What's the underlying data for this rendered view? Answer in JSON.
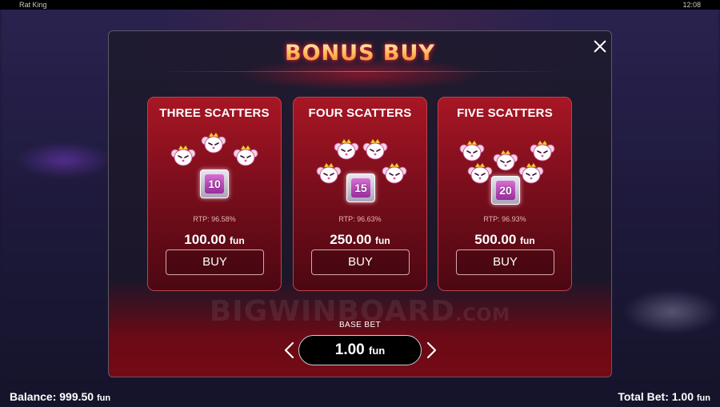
{
  "window": {
    "title": "Rat King",
    "clock": "12:08"
  },
  "modal": {
    "title": "BONUS BUY",
    "close_icon": "close-icon"
  },
  "cards": [
    {
      "title": "THREE SCATTERS",
      "rtp": "RTP: 96.58%",
      "price": "100.00",
      "unit": "fun",
      "buy": "BUY",
      "tile": "10"
    },
    {
      "title": "FOUR SCATTERS",
      "rtp": "RTP: 96.63%",
      "price": "250.00",
      "unit": "fun",
      "buy": "BUY",
      "tile": "15"
    },
    {
      "title": "FIVE SCATTERS",
      "rtp": "RTP: 96.93%",
      "price": "500.00",
      "unit": "fun",
      "buy": "BUY",
      "tile": "20"
    }
  ],
  "watermark": {
    "main": "BIGWINBOARD",
    "suffix": ".COM"
  },
  "base_bet": {
    "label": "BASE BET",
    "value": "1.00",
    "unit": "fun",
    "prev_icon": "chevron-left-icon",
    "next_icon": "chevron-right-icon"
  },
  "footer": {
    "balance_label": "Balance:",
    "balance_value": "999.50",
    "balance_unit": "fun",
    "total_bet_label": "Total Bet:",
    "total_bet_value": "1.00",
    "total_bet_unit": "fun"
  },
  "colors": {
    "title_gold": "#ffb653",
    "card_red": "#a81624",
    "modal_bg": "#1e1a2e",
    "tile_purple": "#d86fd1"
  }
}
